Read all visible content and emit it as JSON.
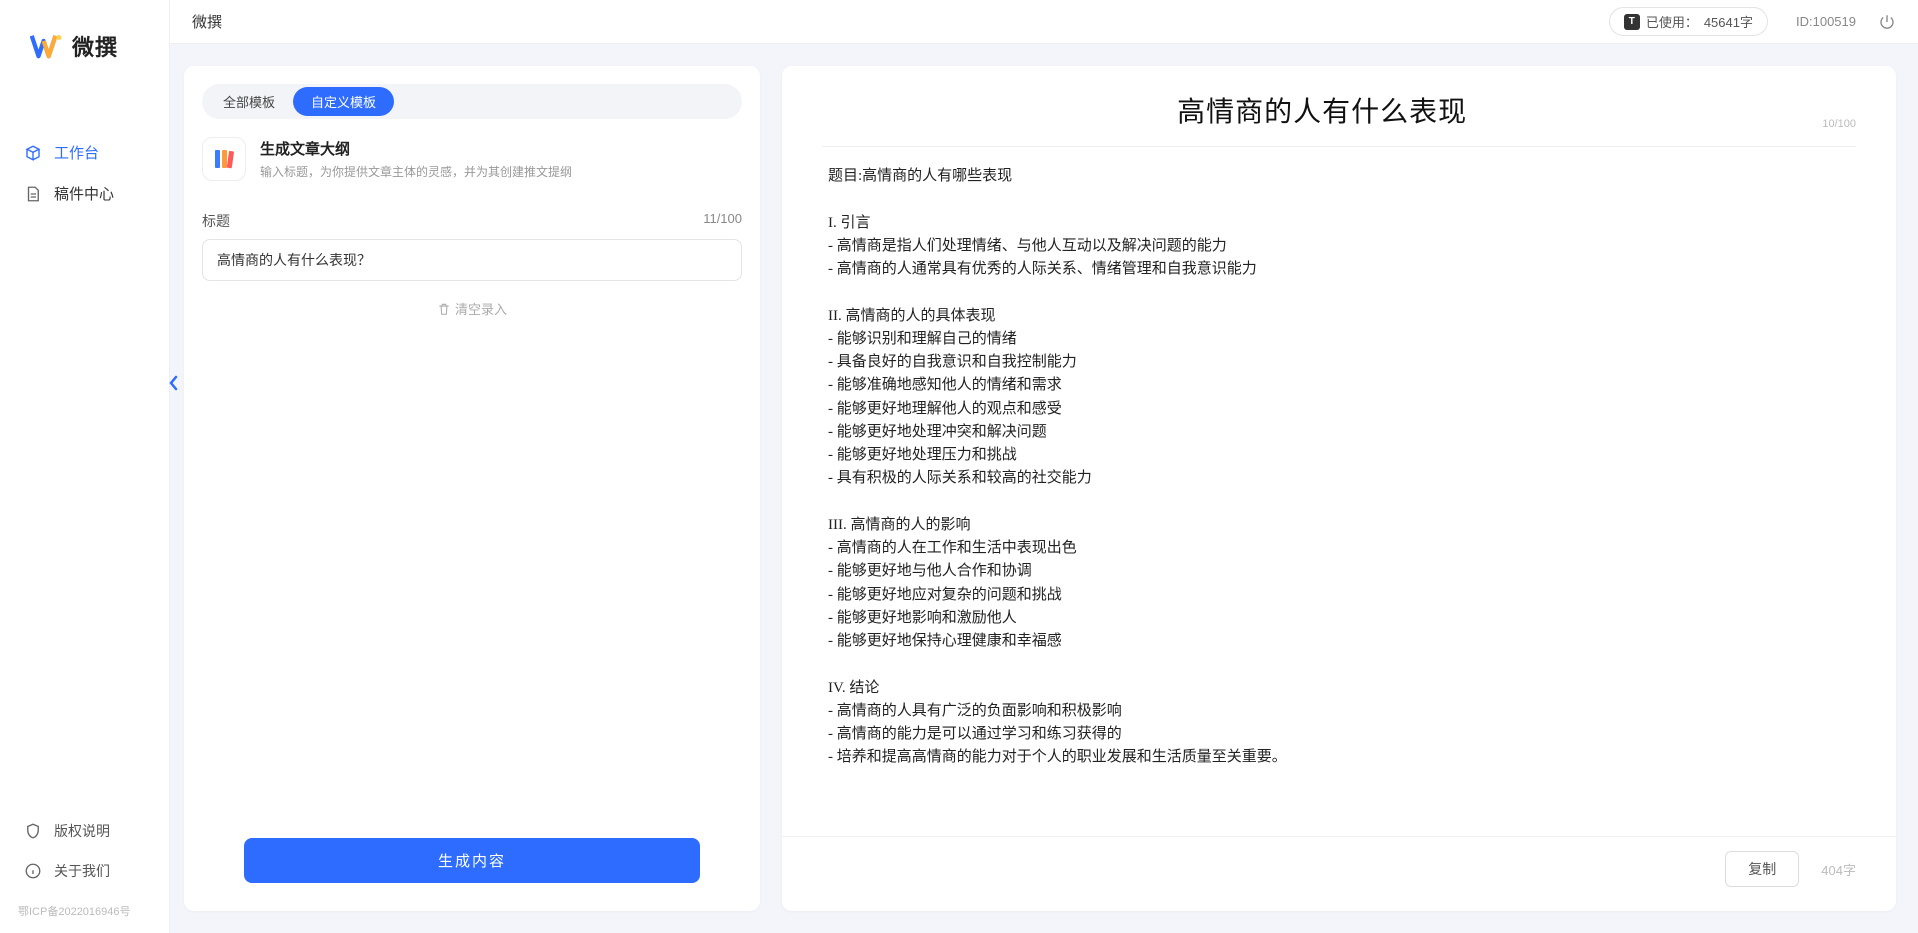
{
  "app": {
    "name": "微撰",
    "logoColors": {
      "a": "#2d6cff",
      "b": "#ffaa33",
      "c": "#ffd24d"
    }
  },
  "sidebar": {
    "items": [
      {
        "label": "工作台",
        "icon": "cube",
        "active": true
      },
      {
        "label": "稿件中心",
        "icon": "doc",
        "active": false
      }
    ],
    "bottom": [
      {
        "label": "版权说明",
        "icon": "shield"
      },
      {
        "label": "关于我们",
        "icon": "info"
      }
    ],
    "icp": "鄂ICP备2022016946号"
  },
  "topbar": {
    "title": "微撰",
    "usagePrefix": "已使用：",
    "usageValue": "45641字",
    "idPrefix": "ID:",
    "idValue": "100519"
  },
  "left": {
    "tabs": [
      {
        "label": "全部模板",
        "active": false
      },
      {
        "label": "自定义模板",
        "active": true
      }
    ],
    "template": {
      "title": "生成文章大纲",
      "desc": "输入标题，为你提供文章主体的灵感，并为其创建推文提纲"
    },
    "form": {
      "label": "标题",
      "counter": "11/100",
      "value": "高情商的人有什么表现？",
      "clear": "清空录入",
      "generate": "生成内容"
    }
  },
  "right": {
    "title": "高情商的人有什么表现",
    "topCounter": "10/100",
    "body": "题目:高情商的人有哪些表现\n\nI. 引言\n- 高情商是指人们处理情绪、与他人互动以及解决问题的能力\n- 高情商的人通常具有优秀的人际关系、情绪管理和自我意识能力\n\nII. 高情商的人的具体表现\n- 能够识别和理解自己的情绪\n- 具备良好的自我意识和自我控制能力\n- 能够准确地感知他人的情绪和需求\n- 能够更好地理解他人的观点和感受\n- 能够更好地处理冲突和解决问题\n- 能够更好地处理压力和挑战\n- 具有积极的人际关系和较高的社交能力\n\nIII. 高情商的人的影响\n- 高情商的人在工作和生活中表现出色\n- 能够更好地与他人合作和协调\n- 能够更好地应对复杂的问题和挑战\n- 能够更好地影响和激励他人\n- 能够更好地保持心理健康和幸福感\n\nIV. 结论\n- 高情商的人具有广泛的负面影响和积极影响\n- 高情商的能力是可以通过学习和练习获得的\n- 培养和提高高情商的能力对于个人的职业发展和生活质量至关重要。",
    "copy": "复制",
    "charCount": "404字"
  }
}
